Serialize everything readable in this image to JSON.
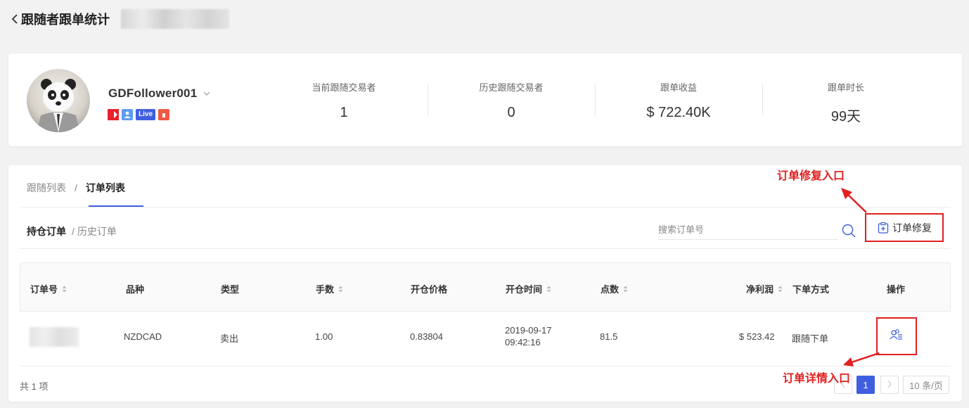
{
  "header": {
    "back_icon": "chevron-left-icon",
    "title": "跟随者跟单统计"
  },
  "profile": {
    "username": "GDFollower001",
    "badges": {
      "live_label": "Live"
    }
  },
  "stats": [
    {
      "label": "当前跟随交易者",
      "value": "1"
    },
    {
      "label": "历史跟随交易者",
      "value": "0"
    },
    {
      "label": "跟单收益",
      "value": "$ 722.40K"
    },
    {
      "label": "跟单时长",
      "value": "99天"
    }
  ],
  "breadcrumb": {
    "items": [
      {
        "label": "跟随列表"
      },
      {
        "label": "订单列表"
      }
    ],
    "separator": "/"
  },
  "subtabs": {
    "active": "持仓订单",
    "separator": "/",
    "inactive": "历史订单"
  },
  "search": {
    "placeholder": "搜索订单号"
  },
  "repair_button": {
    "label": "订单修复"
  },
  "table": {
    "columns": [
      "订单号",
      "品种",
      "类型",
      "手数",
      "开仓价格",
      "开仓时间",
      "点数",
      "净利润",
      "下单方式",
      "操作"
    ],
    "rows": [
      {
        "symbol": "NZDCAD",
        "type": "卖出",
        "lots": "1.00",
        "open_price": "0.83804",
        "open_date": "2019-09-17",
        "open_time": "09:42:16",
        "points": "81.5",
        "net_profit": "$ 523.42",
        "order_method": "跟随下单"
      }
    ]
  },
  "footer": {
    "total": "共 1 项",
    "current_page": "1",
    "page_size": "10 条/页"
  },
  "annotations": {
    "repair_entry": "订单修复入口",
    "detail_entry": "订单详情入口"
  },
  "colors": {
    "accent": "#3f5fe0",
    "annotation_red": "#e02020"
  }
}
